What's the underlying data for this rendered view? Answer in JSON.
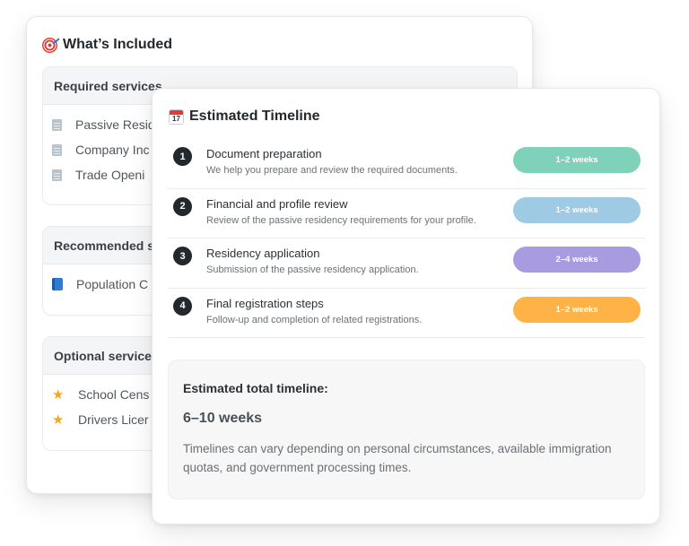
{
  "included": {
    "title": "What’s Included",
    "title_icon": "target-icon",
    "sections": [
      {
        "heading": "Required services",
        "item_icon": "document-icon",
        "items": [
          "Passive Resid",
          "Company Inc",
          "Trade Openi"
        ]
      },
      {
        "heading": "Recommended s",
        "item_icon": "book-icon",
        "items": [
          "Population C"
        ]
      },
      {
        "heading": "Optional service",
        "item_icon": "star-icon",
        "items": [
          "School Cens",
          "Drivers Licer"
        ]
      }
    ]
  },
  "timeline": {
    "title": "Estimated Timeline",
    "title_icon": "calendar-icon",
    "calendar_day": "17",
    "steps": [
      {
        "number": "1",
        "title": "Document preparation",
        "description": "We help you prepare and review the required documents.",
        "duration": "1–2 weeks",
        "color": "#7fd1b9"
      },
      {
        "number": "2",
        "title": "Financial and profile review",
        "description": "Review of the passive residency requirements for your profile.",
        "duration": "1–2 weeks",
        "color": "#9ecae4"
      },
      {
        "number": "3",
        "title": "Residency application",
        "description": "Submission of the passive residency application.",
        "duration": "2–4 weeks",
        "color": "#a89be0"
      },
      {
        "number": "4",
        "title": "Final registration steps",
        "description": "Follow-up and completion of related registrations.",
        "duration": "1–2 weeks",
        "color": "#ffb347"
      }
    ],
    "summary": {
      "label": "Estimated total timeline:",
      "value": "6–10 weeks",
      "note": "Timelines can vary depending on personal circumstances, available immigration quotas, and government processing times."
    }
  }
}
